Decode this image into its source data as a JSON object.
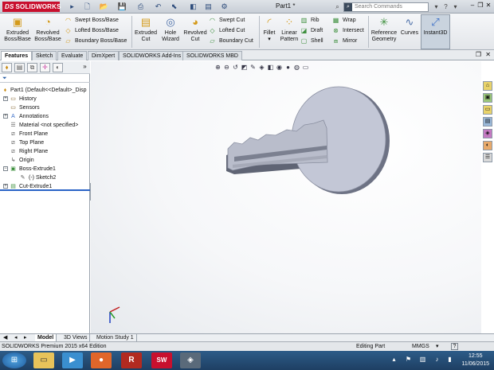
{
  "titlebar": {
    "logo_brand": "DS",
    "logo_text": "SOLIDWORKS",
    "doc_title": "Part1 *",
    "search_placeholder": "Search Commands"
  },
  "commands": {
    "extruded_boss": "Extruded Boss/Base",
    "revolved_boss": "Revolved Boss/Base",
    "swept_boss": "Swept Boss/Base",
    "lofted_boss": "Lofted Boss/Base",
    "boundary_boss": "Boundary Boss/Base",
    "extruded_cut": "Extruded Cut",
    "hole_wizard": "Hole Wizard",
    "revolved_cut": "Revolved Cut",
    "swept_cut": "Swept Cut",
    "lofted_cut": "Lofted Cut",
    "boundary_cut": "Boundary Cut",
    "fillet": "Fillet",
    "linear_pattern": "Linear Pattern",
    "rib": "Rib",
    "draft": "Draft",
    "shell": "Shell",
    "wrap": "Wrap",
    "intersect": "Intersect",
    "mirror": "Mirror",
    "reference_geometry": "Reference Geometry",
    "curves": "Curves",
    "instant3d": "Instant3D"
  },
  "tabs": [
    "Features",
    "Sketch",
    "Evaluate",
    "DimXpert",
    "SOLIDWORKS Add-Ins",
    "SOLIDWORKS MBD"
  ],
  "tree": {
    "root": "Part1  (Default<<Default>_Disp",
    "items": [
      "History",
      "Sensors",
      "Annotations",
      "Material <not specified>",
      "Front Plane",
      "Top Plane",
      "Right Plane",
      "Origin",
      "Boss-Extrude1",
      "(-) Sketch2",
      "Cut-Extrude1"
    ]
  },
  "bottom_tabs": [
    "Model",
    "3D Views",
    "Motion Study 1"
  ],
  "status": {
    "edition": "SOLIDWORKS Premium 2015 x64 Edition",
    "mode": "Editing Part",
    "units": "MMGS",
    "help": "?"
  },
  "clock": {
    "time": "12:55",
    "date": "11/06/2015"
  },
  "colors": {
    "brand_red": "#c8102e",
    "model_face": "#c3c7d6",
    "model_side": "#6d7284",
    "rollback": "#2a63c6"
  }
}
